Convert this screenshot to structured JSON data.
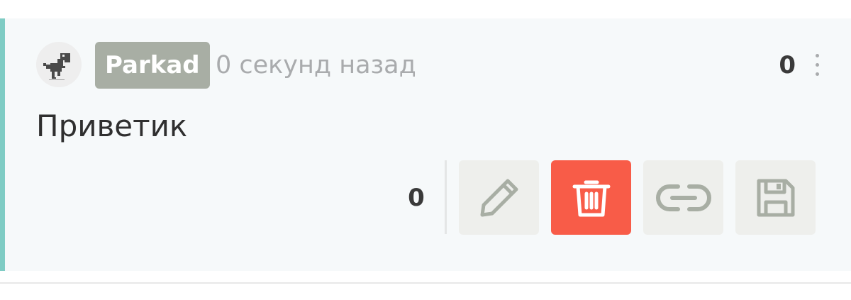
{
  "comment": {
    "author": "Parkad",
    "timestamp": "0 секунд назад",
    "top_score": "0",
    "text": "Приветик",
    "bottom_score": "0",
    "avatar_icon": "dino-icon",
    "menu_icon": "more-vertical-icon"
  },
  "actions": [
    {
      "name": "edit",
      "icon": "pencil-icon"
    },
    {
      "name": "delete",
      "icon": "trash-icon"
    },
    {
      "name": "link",
      "icon": "link-icon"
    },
    {
      "name": "save",
      "icon": "floppy-disk-icon"
    }
  ],
  "colors": {
    "accent_border": "#7fccc4",
    "badge_bg": "#a8aea4",
    "delete_bg": "#f85c48",
    "button_bg": "#eeefec",
    "card_bg": "#f6f9fa"
  }
}
